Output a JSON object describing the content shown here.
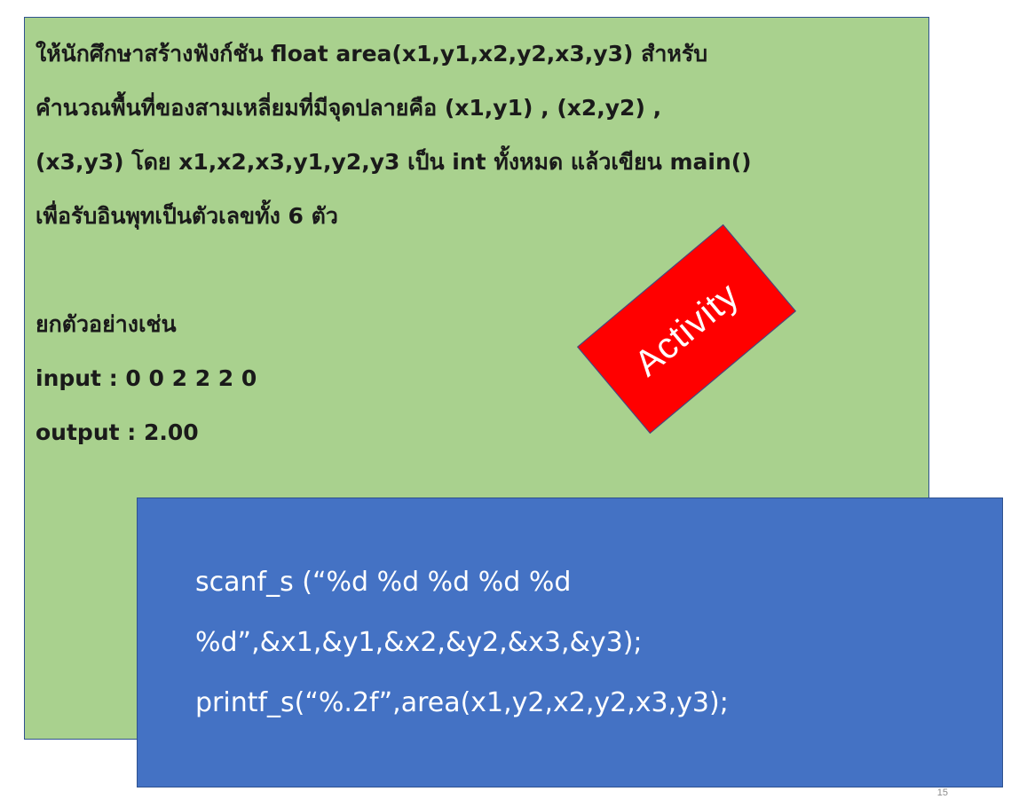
{
  "problem": {
    "lines": [
      "ให้นักศึกษาสร้างฟังก์ชัน float area(x1,y1,x2,y2,x3,y3) สำหรับ",
      "คำนวณพื้นที่ของสามเหลี่ยมที่มีจุดปลายคือ (x1,y1) , (x2,y2) ,",
      "(x3,y3) โดย x1,x2,x3,y1,y2,y3 เป็น int ทั้งหมด แล้วเขียน main()",
      "เพื่อรับอินพุทเป็นตัวเลขทั้ง 6 ตัว"
    ],
    "example_heading": "ยกตัวอย่างเช่น",
    "input_line": "input : 0 0 2 2 2 0",
    "output_line": "output : 2.00"
  },
  "badge": {
    "label": "Activity",
    "color": "#ff0000"
  },
  "code": {
    "lines": [
      "scanf_s (“%d %d %d %d %d",
      "%d”,&x1,&y1,&x2,&y2,&x3,&y3);",
      "printf_s(“%.2f”,area(x1,y2,x2,y2,x3,y3);"
    ]
  },
  "colors": {
    "green_panel": "#a9d18e",
    "blue_panel": "#4472c4",
    "border": "#2f528f"
  },
  "slide": {
    "page_number": "15"
  }
}
